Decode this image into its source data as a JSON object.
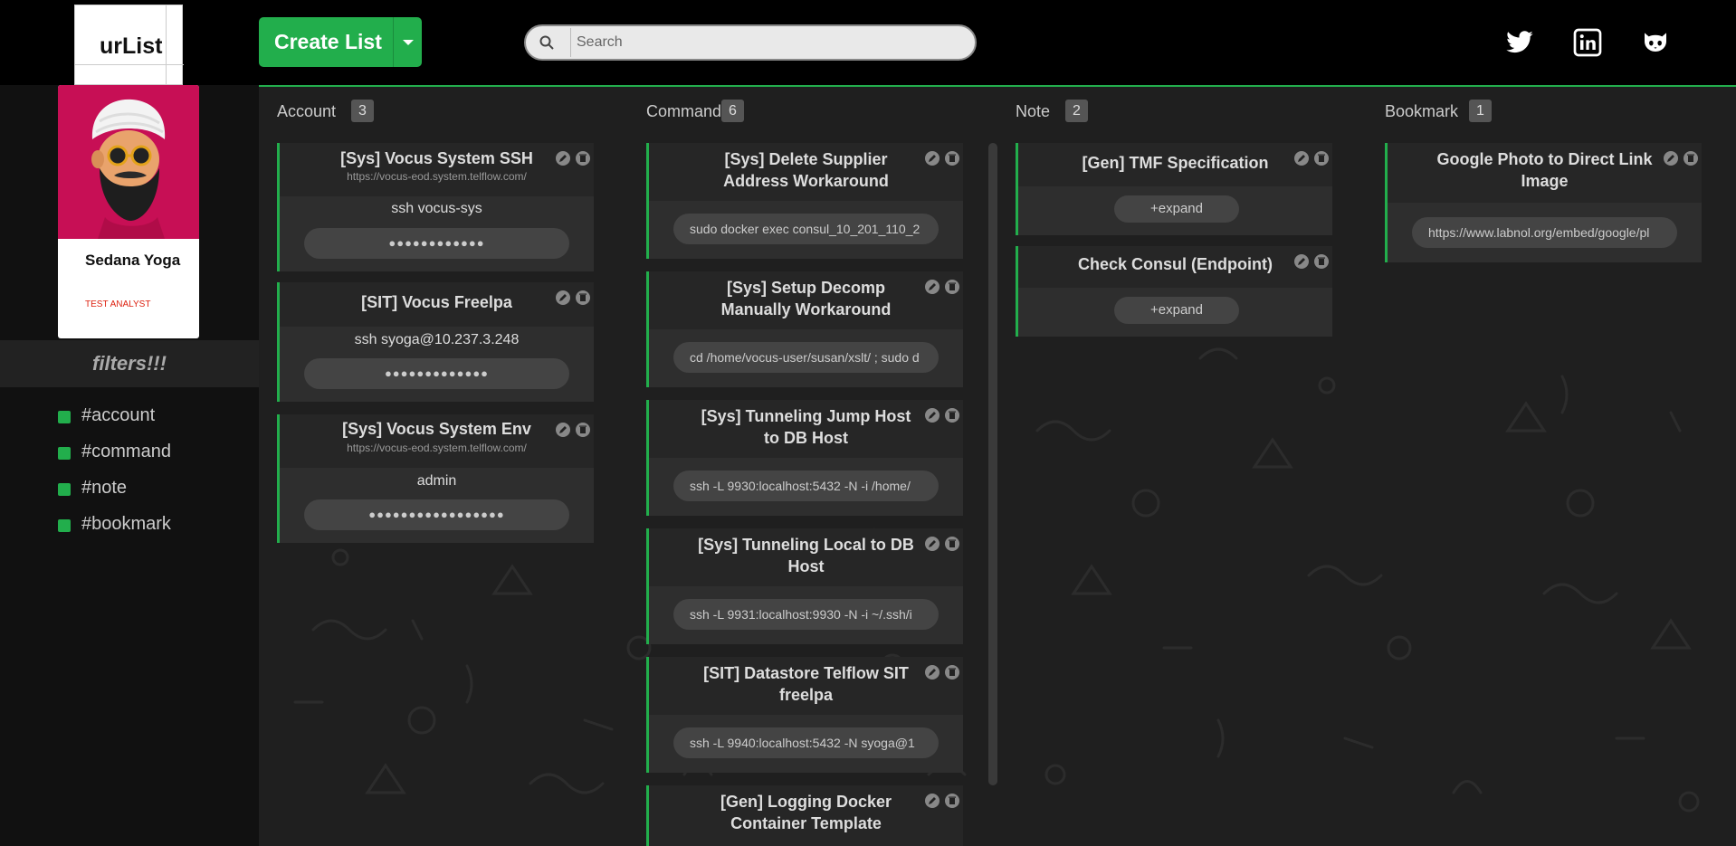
{
  "app": {
    "logo": "urList"
  },
  "toolbar": {
    "create_label": "Create List"
  },
  "search": {
    "placeholder": "Search",
    "value": ""
  },
  "social": [
    "twitter-icon",
    "linkedin-icon",
    "github-icon"
  ],
  "profile": {
    "name": "Sedana Yoga",
    "role": "TEST ANALYST"
  },
  "sidebar": {
    "filters_title": "filters!!!",
    "filters": [
      {
        "label": "#account"
      },
      {
        "label": "#command"
      },
      {
        "label": "#note"
      },
      {
        "label": "#bookmark"
      }
    ]
  },
  "colors": {
    "accent": "#22ae4c",
    "avatar_bg": "#c70f55"
  },
  "columns": [
    {
      "name": "Account",
      "count": "3",
      "cards": [
        {
          "title": "[Sys] Vocus System SSH",
          "url": "https://vocus-eod.system.telflow.com/",
          "username": "ssh vocus-sys",
          "secret": "●●●●●●●●●●●●"
        },
        {
          "title": "[SIT] Vocus Freelpa",
          "url": "",
          "username": "ssh syoga@10.237.3.248",
          "secret": "●●●●●●●●●●●●●"
        },
        {
          "title": "[Sys] Vocus System Env",
          "url": "https://vocus-eod.system.telflow.com/",
          "username": "admin",
          "secret": "●●●●●●●●●●●●●●●●●"
        }
      ]
    },
    {
      "name": "Command",
      "count": "6",
      "cards": [
        {
          "title": "[Sys] Delete Supplier Address Workaround",
          "command": "sudo docker exec consul_10_201_110_2"
        },
        {
          "title": "[Sys] Setup Decomp Manually Workaround",
          "command": "cd /home/vocus-user/susan/xslt/ ; sudo d"
        },
        {
          "title": "[Sys] Tunneling Jump Host to DB Host",
          "command": "ssh -L 9930:localhost:5432 -N -i /home/"
        },
        {
          "title": "[Sys] Tunneling Local to DB Host",
          "command": "ssh -L 9931:localhost:9930 -N -i ~/.ssh/i"
        },
        {
          "title": "[SIT] Datastore Telflow SIT freelpa",
          "command": "ssh -L 9940:localhost:5432 -N syoga@1"
        },
        {
          "title": "[Gen] Logging Docker Container Template",
          "command": ""
        }
      ]
    },
    {
      "name": "Note",
      "count": "2",
      "cards": [
        {
          "title": "[Gen] TMF Specification",
          "action": "+expand"
        },
        {
          "title": "Check Consul (Endpoint)",
          "action": "+expand"
        }
      ]
    },
    {
      "name": "Bookmark",
      "count": "1",
      "cards": [
        {
          "title": "Google Photo to Direct Link Image",
          "link": "https://www.labnol.org/embed/google/pl"
        }
      ]
    }
  ]
}
